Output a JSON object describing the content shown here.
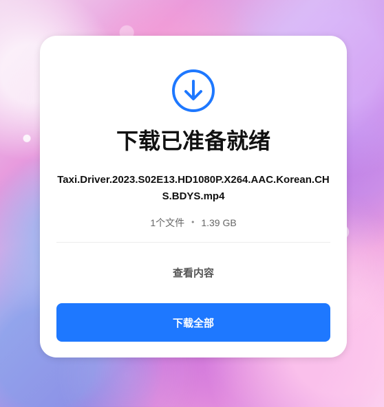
{
  "page": {
    "title": "下载已准备就绪",
    "file_name": "Taxi.Driver.2023.S02E13.HD1080P.X264.AAC.Korean.CHS.BDYS.mp4",
    "file_count": "1个文件",
    "separator": "•",
    "file_size": "1.39 GB",
    "view_content_label": "查看内容",
    "download_all_label": "下载全部"
  },
  "icons": {
    "download_icon": "download-icon"
  },
  "colors": {
    "accent": "#1e78ff",
    "card": "#ffffff",
    "title": "#111111",
    "meta": "#666666"
  }
}
